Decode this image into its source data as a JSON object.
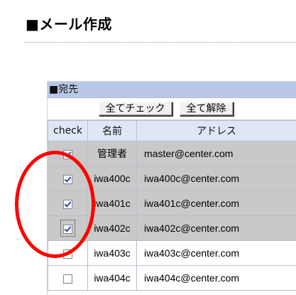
{
  "page": {
    "title": "■メール作成"
  },
  "recipients": {
    "section_title": "■宛先",
    "check_all_label": "全てチェック",
    "uncheck_all_label": "全て解除",
    "columns": {
      "check": "check",
      "name": "名前",
      "address": "アドレス"
    },
    "rows": [
      {
        "checked": true,
        "name": "管理者",
        "address": "master@center.com"
      },
      {
        "checked": true,
        "name": "iwa400c",
        "address": "iwa400c@center.com"
      },
      {
        "checked": true,
        "name": "iwa401c",
        "address": "iwa401c@center.com"
      },
      {
        "checked": true,
        "name": "iwa402c",
        "address": "iwa402c@center.com",
        "focused": true
      },
      {
        "checked": false,
        "name": "iwa403c",
        "address": "iwa403c@center.com"
      },
      {
        "checked": false,
        "name": "iwa404c",
        "address": "iwa404c@center.com"
      }
    ]
  },
  "colors": {
    "highlight": "#ff0000",
    "header_bg": "#b9c8e6",
    "checked_row_bg": "#c9c9c9"
  }
}
